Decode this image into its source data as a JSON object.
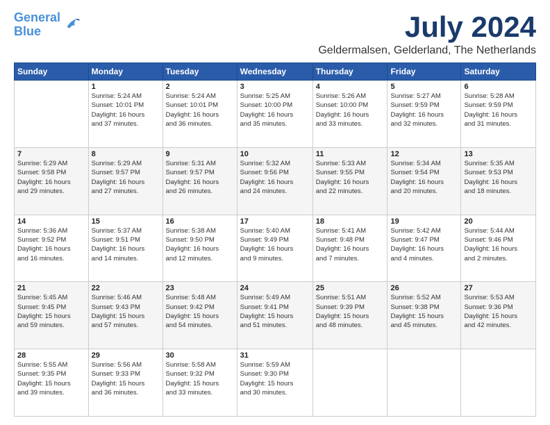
{
  "logo": {
    "line1": "General",
    "line2": "Blue"
  },
  "title": "July 2024",
  "location": "Geldermalsen, Gelderland, The Netherlands",
  "days_header": [
    "Sunday",
    "Monday",
    "Tuesday",
    "Wednesday",
    "Thursday",
    "Friday",
    "Saturday"
  ],
  "weeks": [
    [
      {
        "day": "",
        "info": ""
      },
      {
        "day": "1",
        "info": "Sunrise: 5:24 AM\nSunset: 10:01 PM\nDaylight: 16 hours\nand 37 minutes."
      },
      {
        "day": "2",
        "info": "Sunrise: 5:24 AM\nSunset: 10:01 PM\nDaylight: 16 hours\nand 36 minutes."
      },
      {
        "day": "3",
        "info": "Sunrise: 5:25 AM\nSunset: 10:00 PM\nDaylight: 16 hours\nand 35 minutes."
      },
      {
        "day": "4",
        "info": "Sunrise: 5:26 AM\nSunset: 10:00 PM\nDaylight: 16 hours\nand 33 minutes."
      },
      {
        "day": "5",
        "info": "Sunrise: 5:27 AM\nSunset: 9:59 PM\nDaylight: 16 hours\nand 32 minutes."
      },
      {
        "day": "6",
        "info": "Sunrise: 5:28 AM\nSunset: 9:59 PM\nDaylight: 16 hours\nand 31 minutes."
      }
    ],
    [
      {
        "day": "7",
        "info": "Sunrise: 5:29 AM\nSunset: 9:58 PM\nDaylight: 16 hours\nand 29 minutes."
      },
      {
        "day": "8",
        "info": "Sunrise: 5:29 AM\nSunset: 9:57 PM\nDaylight: 16 hours\nand 27 minutes."
      },
      {
        "day": "9",
        "info": "Sunrise: 5:31 AM\nSunset: 9:57 PM\nDaylight: 16 hours\nand 26 minutes."
      },
      {
        "day": "10",
        "info": "Sunrise: 5:32 AM\nSunset: 9:56 PM\nDaylight: 16 hours\nand 24 minutes."
      },
      {
        "day": "11",
        "info": "Sunrise: 5:33 AM\nSunset: 9:55 PM\nDaylight: 16 hours\nand 22 minutes."
      },
      {
        "day": "12",
        "info": "Sunrise: 5:34 AM\nSunset: 9:54 PM\nDaylight: 16 hours\nand 20 minutes."
      },
      {
        "day": "13",
        "info": "Sunrise: 5:35 AM\nSunset: 9:53 PM\nDaylight: 16 hours\nand 18 minutes."
      }
    ],
    [
      {
        "day": "14",
        "info": "Sunrise: 5:36 AM\nSunset: 9:52 PM\nDaylight: 16 hours\nand 16 minutes."
      },
      {
        "day": "15",
        "info": "Sunrise: 5:37 AM\nSunset: 9:51 PM\nDaylight: 16 hours\nand 14 minutes."
      },
      {
        "day": "16",
        "info": "Sunrise: 5:38 AM\nSunset: 9:50 PM\nDaylight: 16 hours\nand 12 minutes."
      },
      {
        "day": "17",
        "info": "Sunrise: 5:40 AM\nSunset: 9:49 PM\nDaylight: 16 hours\nand 9 minutes."
      },
      {
        "day": "18",
        "info": "Sunrise: 5:41 AM\nSunset: 9:48 PM\nDaylight: 16 hours\nand 7 minutes."
      },
      {
        "day": "19",
        "info": "Sunrise: 5:42 AM\nSunset: 9:47 PM\nDaylight: 16 hours\nand 4 minutes."
      },
      {
        "day": "20",
        "info": "Sunrise: 5:44 AM\nSunset: 9:46 PM\nDaylight: 16 hours\nand 2 minutes."
      }
    ],
    [
      {
        "day": "21",
        "info": "Sunrise: 5:45 AM\nSunset: 9:45 PM\nDaylight: 15 hours\nand 59 minutes."
      },
      {
        "day": "22",
        "info": "Sunrise: 5:46 AM\nSunset: 9:43 PM\nDaylight: 15 hours\nand 57 minutes."
      },
      {
        "day": "23",
        "info": "Sunrise: 5:48 AM\nSunset: 9:42 PM\nDaylight: 15 hours\nand 54 minutes."
      },
      {
        "day": "24",
        "info": "Sunrise: 5:49 AM\nSunset: 9:41 PM\nDaylight: 15 hours\nand 51 minutes."
      },
      {
        "day": "25",
        "info": "Sunrise: 5:51 AM\nSunset: 9:39 PM\nDaylight: 15 hours\nand 48 minutes."
      },
      {
        "day": "26",
        "info": "Sunrise: 5:52 AM\nSunset: 9:38 PM\nDaylight: 15 hours\nand 45 minutes."
      },
      {
        "day": "27",
        "info": "Sunrise: 5:53 AM\nSunset: 9:36 PM\nDaylight: 15 hours\nand 42 minutes."
      }
    ],
    [
      {
        "day": "28",
        "info": "Sunrise: 5:55 AM\nSunset: 9:35 PM\nDaylight: 15 hours\nand 39 minutes."
      },
      {
        "day": "29",
        "info": "Sunrise: 5:56 AM\nSunset: 9:33 PM\nDaylight: 15 hours\nand 36 minutes."
      },
      {
        "day": "30",
        "info": "Sunrise: 5:58 AM\nSunset: 9:32 PM\nDaylight: 15 hours\nand 33 minutes."
      },
      {
        "day": "31",
        "info": "Sunrise: 5:59 AM\nSunset: 9:30 PM\nDaylight: 15 hours\nand 30 minutes."
      },
      {
        "day": "",
        "info": ""
      },
      {
        "day": "",
        "info": ""
      },
      {
        "day": "",
        "info": ""
      }
    ]
  ]
}
